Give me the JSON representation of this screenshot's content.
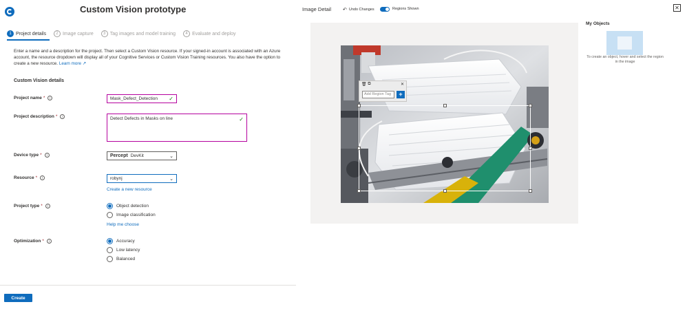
{
  "header": {
    "title": "Custom Vision prototype"
  },
  "steps": [
    {
      "num": "1",
      "label": "Project details"
    },
    {
      "num": "2",
      "label": "Image capture"
    },
    {
      "num": "3",
      "label": "Tag images and model training"
    },
    {
      "num": "4",
      "label": "Evaluate and deploy"
    }
  ],
  "intro": {
    "text": "Enter a name and a description for the project. Then select a Custom Vision resource. If your signed-in account is associated with an Azure account, the resource dropdown will display all of your Cognitive Services or Custom Vision Training resources. You also have the option to create a new resource.",
    "link": "Learn more ↗"
  },
  "form": {
    "section_title": "Custom Vision details",
    "project_name": {
      "label": "Project name",
      "value": "Mask_Defect_Detection"
    },
    "project_description": {
      "label": "Project description",
      "value": "Detect Defects in Masks on line"
    },
    "device_type": {
      "label": "Device type",
      "value_bold": "Percept",
      "value": "DevKit"
    },
    "resource": {
      "label": "Resource",
      "value": "robynj",
      "create_link": "Create a new resource"
    },
    "project_type": {
      "label": "Project type",
      "options": [
        "Object detection",
        "Image classification"
      ],
      "selected": "Object detection",
      "help_link": "Help me choose"
    },
    "optimization": {
      "label": "Optimization",
      "options": [
        "Accuracy",
        "Low latency",
        "Balanced"
      ],
      "selected": "Accuracy"
    }
  },
  "footer": {
    "create_label": "Create"
  },
  "image_detail": {
    "title": "Image Detail",
    "undo_label": "Undo Changes",
    "regions_label": "Regions Shown",
    "regions_shown": true,
    "tag_placeholder": "Add Region Tag",
    "add_tag_label": "+"
  },
  "objects_panel": {
    "title": "My Objects",
    "help": "To create an object, hover and select the region in the image"
  },
  "colors": {
    "accent": "#0f6cbd",
    "focus_border": "#b4009e",
    "success": "#107c10"
  }
}
